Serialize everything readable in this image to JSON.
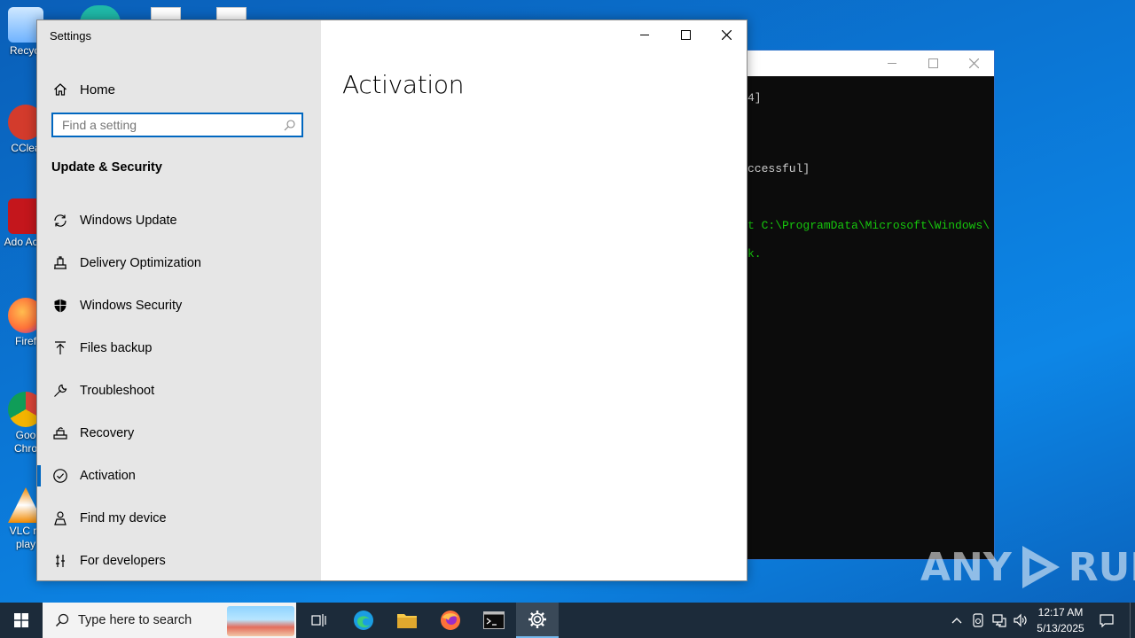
{
  "desktop": {
    "icons": [
      {
        "label": "Recycl",
        "color": "#6fb3ff"
      },
      {
        "label": "CClea",
        "color": "#d33b2c"
      },
      {
        "label": "Ado Acro",
        "color": "#c4161c"
      },
      {
        "label": "Firef",
        "color": "#ff7139"
      },
      {
        "label": "Goo Chro",
        "color": "#1a73e8"
      },
      {
        "label": "VLC m play",
        "color": "#f28a00"
      }
    ]
  },
  "console": {
    "lines": [
      {
        "text": "4]",
        "color": "gray"
      },
      {
        "text": "ccessful]",
        "color": "gray"
      },
      {
        "text": "t C:\\ProgramData\\Microsoft\\Windows\\",
        "color": "green"
      },
      {
        "text": "k.",
        "color": "green"
      }
    ]
  },
  "settings": {
    "window_title": "Settings",
    "home_label": "Home",
    "search_placeholder": "Find a setting",
    "section_title": "Update & Security",
    "nav_items": [
      {
        "label": "Windows Update",
        "icon": "sync-icon"
      },
      {
        "label": "Delivery Optimization",
        "icon": "delivery-optimization-icon"
      },
      {
        "label": "Windows Security",
        "icon": "shield-icon"
      },
      {
        "label": "Files backup",
        "icon": "backup-arrow-icon"
      },
      {
        "label": "Troubleshoot",
        "icon": "wrench-icon"
      },
      {
        "label": "Recovery",
        "icon": "recovery-icon"
      },
      {
        "label": "Activation",
        "icon": "check-circle-icon",
        "active": true
      },
      {
        "label": "Find my device",
        "icon": "person-locate-icon"
      },
      {
        "label": "For developers",
        "icon": "developer-tools-icon"
      }
    ],
    "page_title": "Activation",
    "accent_color": "#0067c0"
  },
  "watermark": {
    "text_left": "ANY",
    "text_right": "RUN"
  },
  "taskbar": {
    "search_text": "Type here to search",
    "clock_time": "12:17 AM",
    "clock_date": "5/13/2025"
  }
}
